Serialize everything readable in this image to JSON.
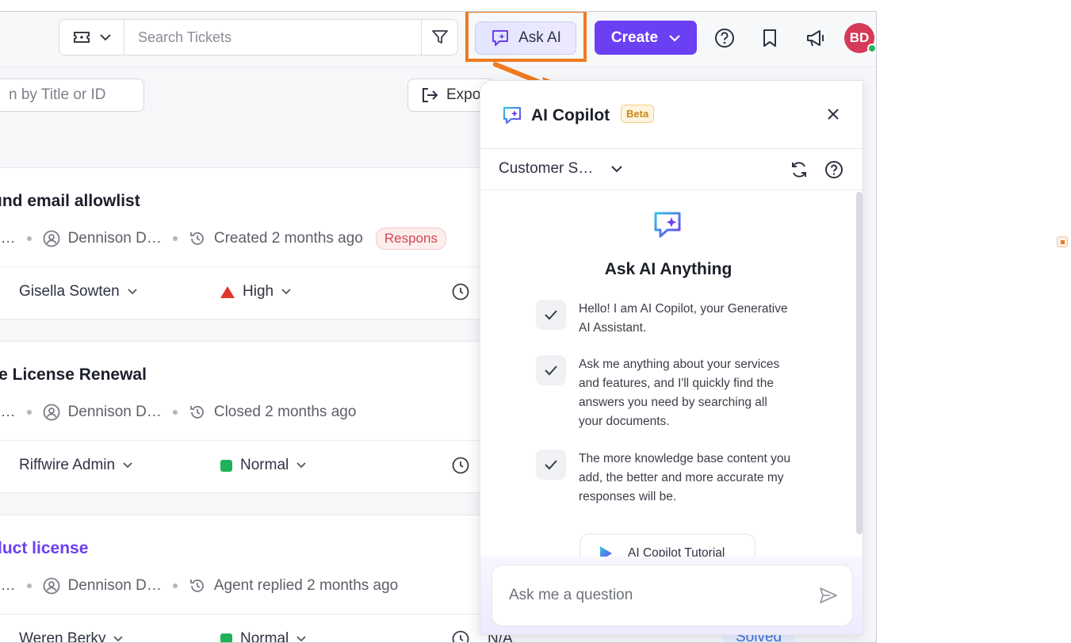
{
  "topbar": {
    "search": {
      "placeholder": "Search Tickets",
      "value": ""
    },
    "ask_ai_label": "Ask AI",
    "create_label": "Create",
    "avatar_initials": "BD",
    "accent_color": "#6b3ff2",
    "highlight_color": "#f07a1f"
  },
  "toolbar": {
    "title_search_placeholder": "n by Title or ID",
    "export_label": "Expo"
  },
  "tickets": [
    {
      "title": "und email allowlist",
      "creator_prefix": "o…",
      "creator": "Dennison D…",
      "activity": "Created 2 months ago",
      "badge": "Respons",
      "assignee": "Gisella Sowten",
      "priority": "High",
      "priority_color": "#e0362c"
    },
    {
      "title": "re License Renewal",
      "creator_prefix": "o…",
      "creator": "Dennison D…",
      "activity": "Closed 2 months ago",
      "assignee": "Riffwire Admin",
      "priority": "Normal",
      "priority_color": "#21b15a"
    },
    {
      "title": "duct license",
      "creator_prefix": "o…",
      "creator": "Dennison D…",
      "activity": "Agent replied 2 months ago",
      "assignee": "Weren Berky",
      "priority": "Normal",
      "priority_color": "#21b15a",
      "due": "N/A",
      "status": "Solved"
    }
  ],
  "copilot": {
    "title": "AI Copilot",
    "badge": "Beta",
    "context_select": "Customer S…",
    "heading": "Ask AI Anything",
    "features": [
      "Hello! I am AI Copilot, your Generative AI Assistant.",
      "Ask me anything about your services and features, and I'll quickly find the answers you need by searching all your documents.",
      "The more knowledge base content you add, the better and more accurate my responses will be."
    ],
    "tutorial_label": "AI Copilot Tutorial",
    "input_placeholder": "Ask me a question"
  }
}
